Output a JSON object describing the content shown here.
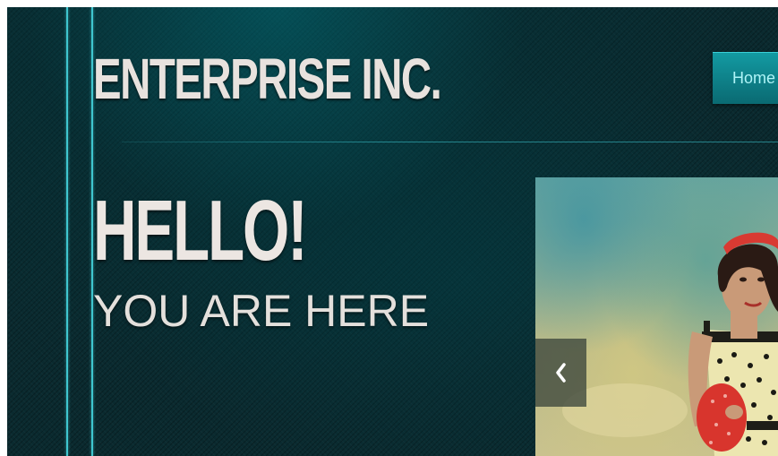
{
  "header": {
    "logo": "ENTERPRISE INC.",
    "nav": [
      {
        "label": "Home"
      }
    ]
  },
  "hero": {
    "headline": "HELLO!",
    "subheadline": "YOU ARE HERE"
  },
  "slider": {
    "prev_icon": "chevron-left-icon",
    "image_subject": "woman in polka-dot dress with red headband holding red hat"
  },
  "colors": {
    "background": "#0a2a2f",
    "accent": "#3fc6cf",
    "nav_button": "#0f8a92",
    "text": "#ece6e2"
  }
}
